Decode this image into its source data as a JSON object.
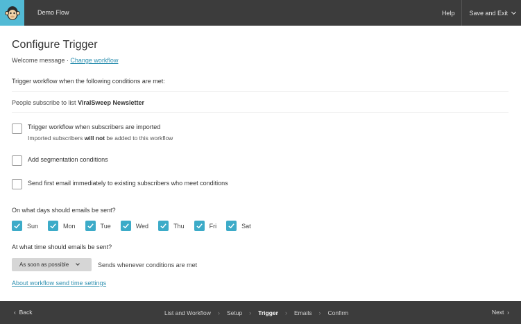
{
  "header": {
    "logo_icon": "monkey-logo-icon",
    "flow_title": "Demo Flow",
    "help_label": "Help",
    "save_exit_label": "Save and Exit"
  },
  "main": {
    "title": "Configure Trigger",
    "workflow_name": "Welcome message",
    "separator": "·",
    "change_workflow_label": "Change workflow",
    "conditions_heading": "Trigger workflow when the following conditions are met:",
    "condition_prefix": "People subscribe to list",
    "condition_list": "ViralSweep Newsletter",
    "options": [
      {
        "label": "Trigger workflow when subscribers are imported",
        "checked": false,
        "sub_before": "Imported subscribers",
        "sub_bold": "will not",
        "sub_after": "be added to this workflow"
      },
      {
        "label": "Add segmentation conditions",
        "checked": false
      },
      {
        "label": "Send first email immediately to existing subscribers who meet conditions",
        "checked": false
      }
    ],
    "days_question": "On what days should emails be sent?",
    "days": [
      {
        "label": "Sun",
        "checked": true
      },
      {
        "label": "Mon",
        "checked": true
      },
      {
        "label": "Tue",
        "checked": true
      },
      {
        "label": "Wed",
        "checked": true
      },
      {
        "label": "Thu",
        "checked": true
      },
      {
        "label": "Fri",
        "checked": true
      },
      {
        "label": "Sat",
        "checked": true
      }
    ],
    "time_question": "At what time should emails be sent?",
    "time_selected": "As soon as possible",
    "time_help": "Sends whenever conditions are met",
    "about_link": "About workflow send time settings"
  },
  "footer": {
    "back_label": "Back",
    "next_label": "Next",
    "steps": [
      "List and Workflow",
      "Setup",
      "Trigger",
      "Emails",
      "Confirm"
    ],
    "active_step": "Trigger"
  },
  "colors": {
    "header_bg": "#3c3c3c",
    "logo_bg": "#52bad5",
    "accent": "#3cabc8",
    "link": "#2e90b0"
  }
}
